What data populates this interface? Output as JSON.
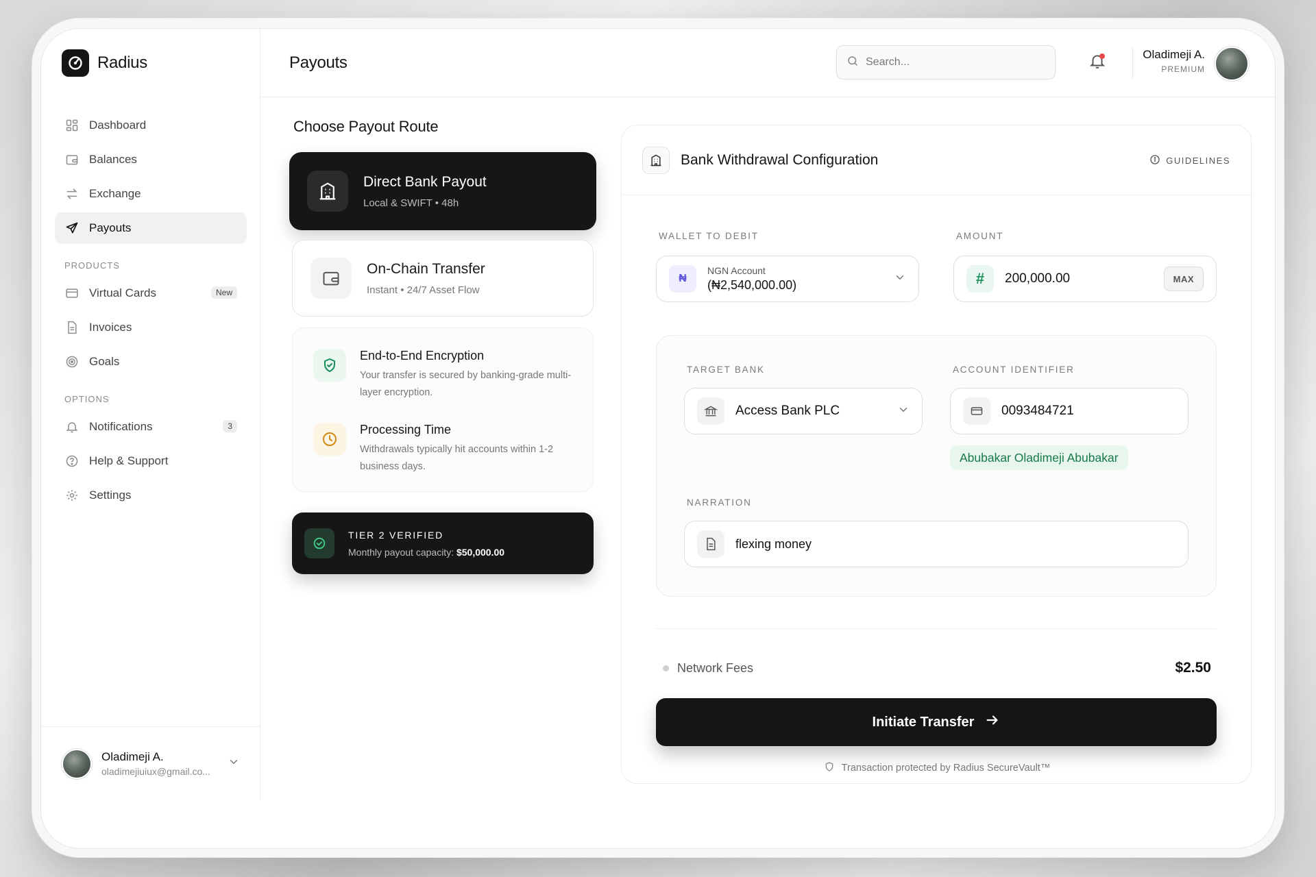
{
  "brand": {
    "name": "Radius"
  },
  "sidebar": {
    "main_items": [
      {
        "label": "Dashboard",
        "icon": "grid-icon"
      },
      {
        "label": "Balances",
        "icon": "wallet-icon"
      },
      {
        "label": "Exchange",
        "icon": "swap-icon"
      },
      {
        "label": "Payouts",
        "icon": "send-icon",
        "active": true
      }
    ],
    "products_label": "PRODUCTS",
    "products": [
      {
        "label": "Virtual Cards",
        "icon": "card-icon",
        "badge": "New"
      },
      {
        "label": "Invoices",
        "icon": "document-icon"
      },
      {
        "label": "Goals",
        "icon": "target-icon"
      }
    ],
    "options_label": "OPTIONS",
    "options": [
      {
        "label": "Notifications",
        "icon": "bell-icon",
        "badge": "3"
      },
      {
        "label": "Help & Support",
        "icon": "help-icon"
      },
      {
        "label": "Settings",
        "icon": "gear-icon"
      }
    ],
    "footer": {
      "name": "Oladimeji A.",
      "email": "oladimejiuiux@gmail.co..."
    }
  },
  "header": {
    "title": "Payouts",
    "search_placeholder": "Search...",
    "user_name": "Oladimeji A.",
    "user_tier": "PREMIUM"
  },
  "routes": {
    "title": "Choose Payout Route",
    "items": [
      {
        "title": "Direct Bank Payout",
        "subtitle": "Local & SWIFT • 48h",
        "active": true
      },
      {
        "title": "On-Chain Transfer",
        "subtitle": "Instant • 24/7 Asset Flow",
        "active": false
      }
    ]
  },
  "info": [
    {
      "title": "End-to-End Encryption",
      "text": "Your transfer is secured by banking-grade multi-layer encryption."
    },
    {
      "title": "Processing Time",
      "text": "Withdrawals typically hit accounts within 1-2 business days."
    }
  ],
  "tier": {
    "title": "TIER 2 VERIFIED",
    "text": "Monthly payout capacity:",
    "amount": "$50,000.00"
  },
  "config": {
    "title": "Bank Withdrawal Configuration",
    "guidelines": "GUIDELINES",
    "wallet_label": "WALLET TO DEBIT",
    "wallet_name": "NGN Account",
    "wallet_balance": "(₦2,540,000.00)",
    "wallet_symbol": "₦",
    "amount_label": "AMOUNT",
    "amount_value": "200,000.00",
    "amount_symbol": "#",
    "max_label": "MAX",
    "bank_label": "TARGET BANK",
    "bank_value": "Access Bank PLC",
    "account_label": "ACCOUNT IDENTIFIER",
    "account_value": "0093484721",
    "account_holder": "Abubakar Oladimeji Abubakar",
    "narration_label": "NARRATION",
    "narration_value": "flexing money",
    "fees_label": "Network Fees",
    "fees_value": "$2.50",
    "cta_label": "Initiate Transfer",
    "secure_note": "Transaction protected by Radius SecureVault™"
  },
  "colors": {
    "primary": "#151515",
    "success": "#1a8f5a",
    "warning": "#d08a14",
    "alert": "#e5484d",
    "naira_accent": "#5b53e0"
  }
}
